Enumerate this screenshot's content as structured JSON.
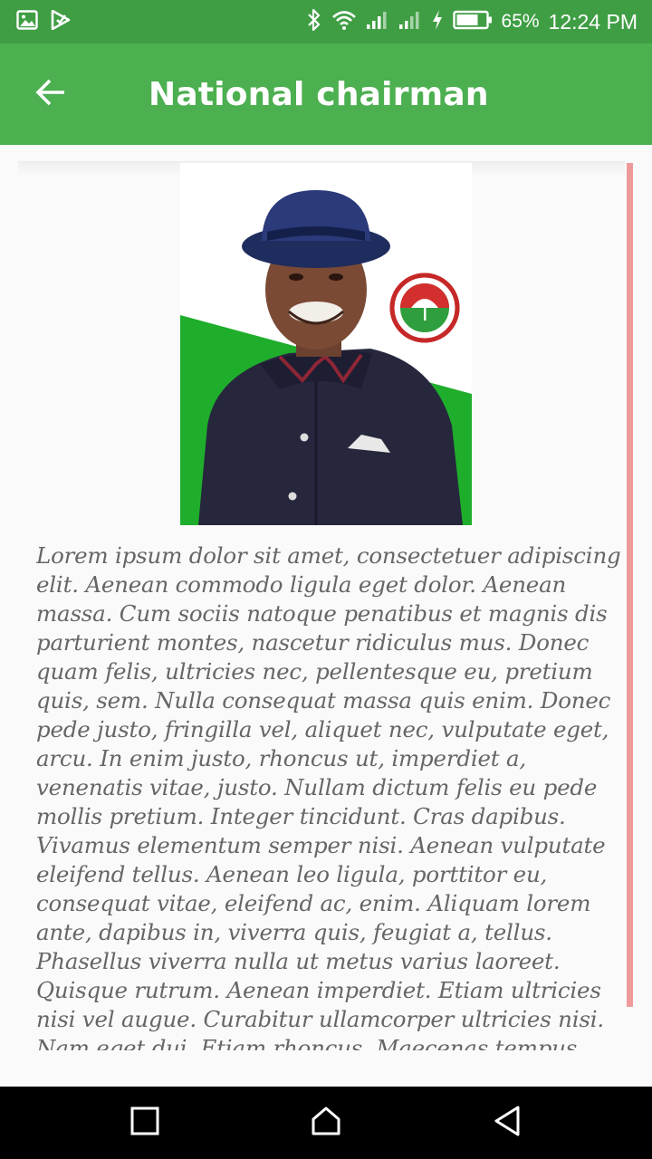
{
  "status_bar": {
    "battery_percent": "65%",
    "time": "12:24 PM",
    "icons": [
      "gallery-icon",
      "play-store-icon",
      "bluetooth-icon",
      "wifi-icon",
      "signal-icon",
      "signal-icon",
      "charging-icon",
      "battery-icon"
    ]
  },
  "app_bar": {
    "title": "National chairman",
    "back_icon": "arrow-left-icon"
  },
  "content": {
    "image_alt": "National chairman portrait",
    "body": "Lorem ipsum dolor sit amet, consectetuer adipiscing elit. Aenean commodo ligula eget dolor. Aenean massa. Cum sociis natoque penatibus et magnis dis parturient montes, nascetur ridiculus mus. Donec quam felis, ultricies nec, pellentesque eu, pretium quis, sem. Nulla consequat massa quis enim. Donec pede justo, fringilla vel, aliquet nec, vulputate eget, arcu. In enim justo, rhoncus ut, imperdiet a, venenatis vitae, justo. Nullam dictum felis eu pede mollis pretium. Integer tincidunt. Cras dapibus. Vivamus elementum semper nisi. Aenean vulputate eleifend tellus. Aenean leo ligula, porttitor eu, consequat vitae, eleifend ac, enim. Aliquam lorem ante, dapibus in, viverra quis, feugiat a, tellus. Phasellus viverra nulla ut metus varius laoreet. Quisque rutrum. Aenean imperdiet. Etiam ultricies nisi vel augue. Curabitur ullamcorper ultricies nisi. Nam eget dui. Etiam rhoncus. Maecenas tempus"
  },
  "nav_bar": {
    "buttons": [
      "recents-square-icon",
      "home-icon",
      "back-triangle-icon"
    ]
  },
  "colors": {
    "status_bar": "#3f9e44",
    "app_bar": "#4caf50",
    "scroll_indicator": "#ef9a9a",
    "body_text": "#666666"
  }
}
